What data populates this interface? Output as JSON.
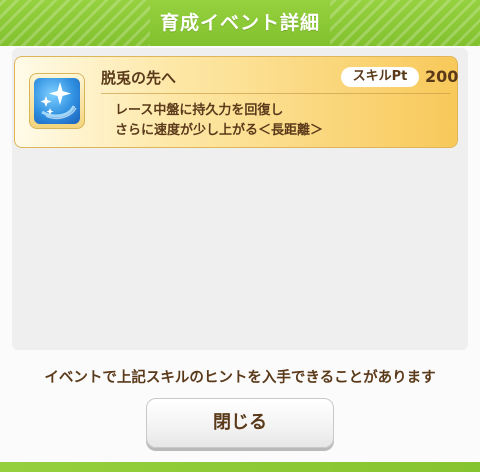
{
  "header": {
    "title": "育成イベント詳細"
  },
  "event": {
    "icon": "sparkle-skill-icon",
    "title": "脱兎の先へ",
    "pt_label": "スキルPt",
    "pt_value": "200",
    "description_line1": "レース中盤に持久力を回復し",
    "description_line2": "さらに速度が少し上がる＜長距離＞"
  },
  "footer": {
    "hint": "イベントで上記スキルのヒントを入手できることがあります",
    "close_label": "閉じる"
  },
  "colors": {
    "header_green": "#8bc934",
    "card_gold": "#f8c95a",
    "text_brown": "#5a3a1a",
    "icon_blue": "#2f8fe0"
  }
}
